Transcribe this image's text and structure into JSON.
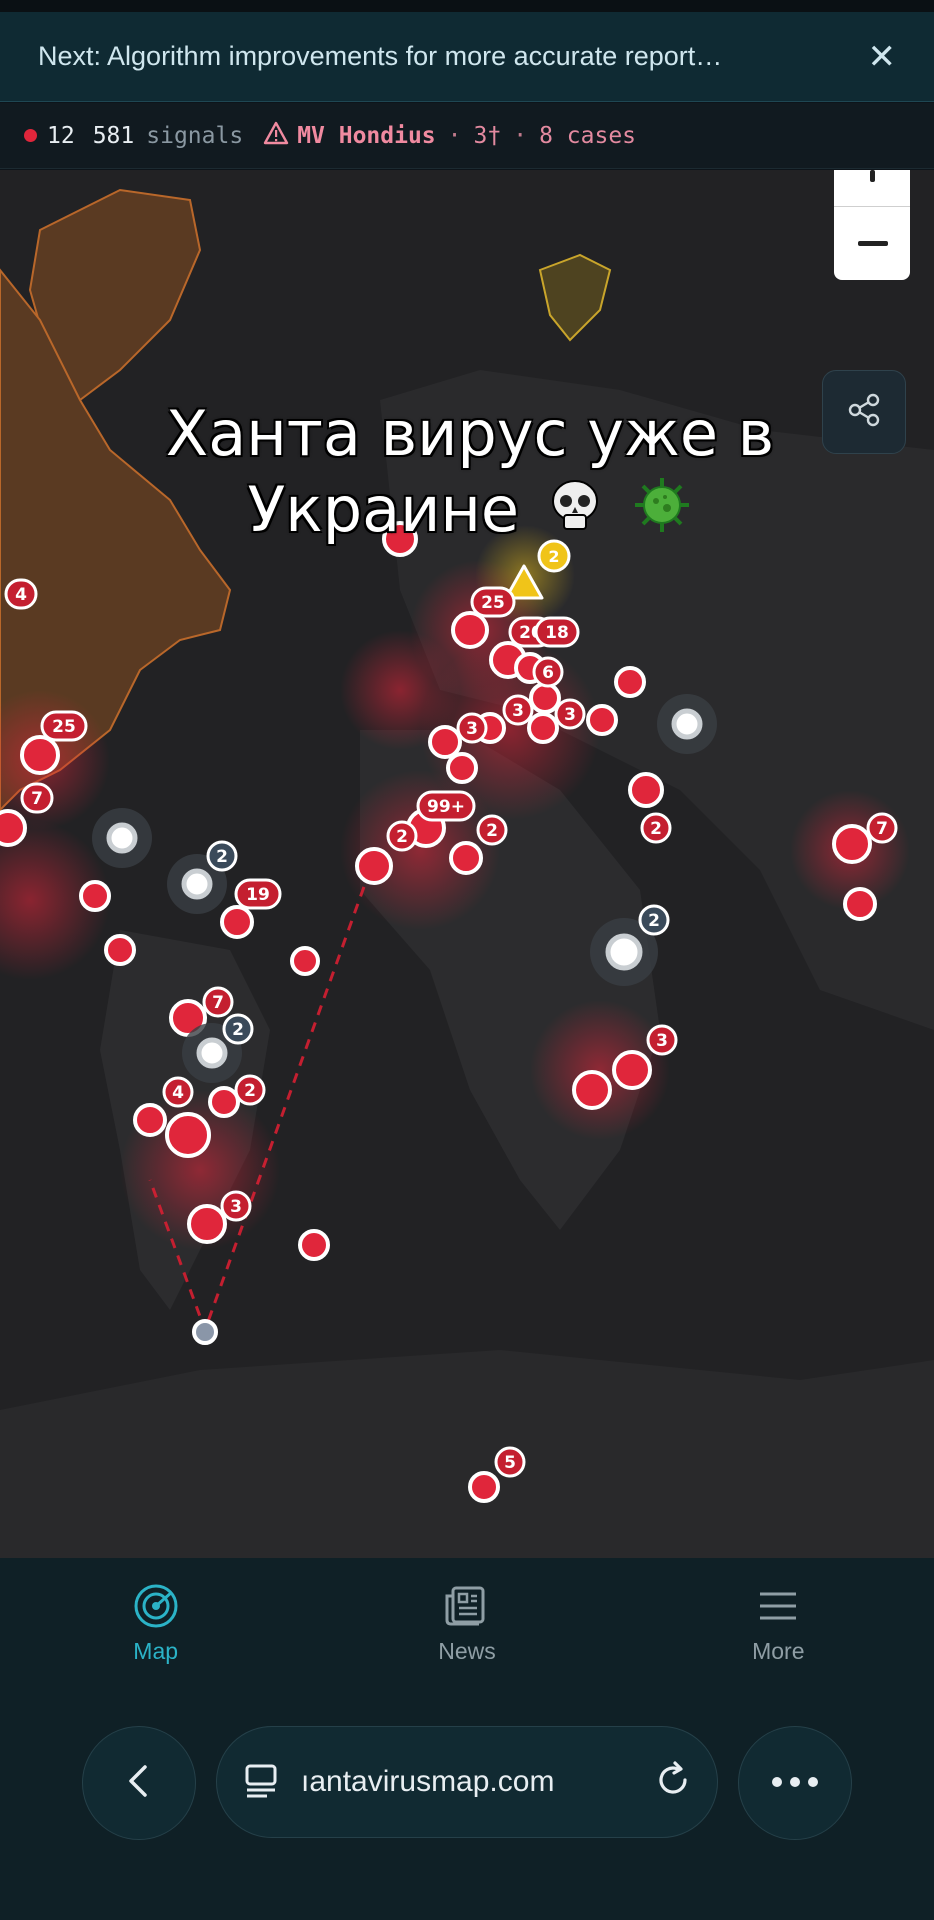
{
  "banner": {
    "text": "Next: Algorithm improvements for more accurate report…",
    "close_glyph": "✕"
  },
  "status": {
    "count": "12",
    "signals_count": "581",
    "signals_label": "signals",
    "vessel": "MV Hondius",
    "separator": "·",
    "deaths": "3†",
    "cases": "8 cases"
  },
  "caption": {
    "line1": "Ханта вирус уже в",
    "line2": "Украине"
  },
  "map": {
    "marker_counts": [
      "4",
      "25",
      "7",
      "2",
      "19",
      "7",
      "2",
      "4",
      "2",
      "3",
      "25",
      "20",
      "18",
      "6",
      "3",
      "3",
      "2",
      "3",
      "99+",
      "2",
      "2",
      "2",
      "3",
      "7",
      "5"
    ],
    "warning_count": "2"
  },
  "nav": {
    "items": [
      {
        "label": "Map",
        "icon": "radar-icon",
        "active": true
      },
      {
        "label": "News",
        "icon": "newspaper-icon",
        "active": false
      },
      {
        "label": "More",
        "icon": "menu-icon",
        "active": false
      }
    ]
  },
  "browser": {
    "url": "ıantavirusmap.com"
  },
  "colors": {
    "accent": "#2bb3c7",
    "danger": "#e0263b",
    "warning": "#f0c419"
  }
}
